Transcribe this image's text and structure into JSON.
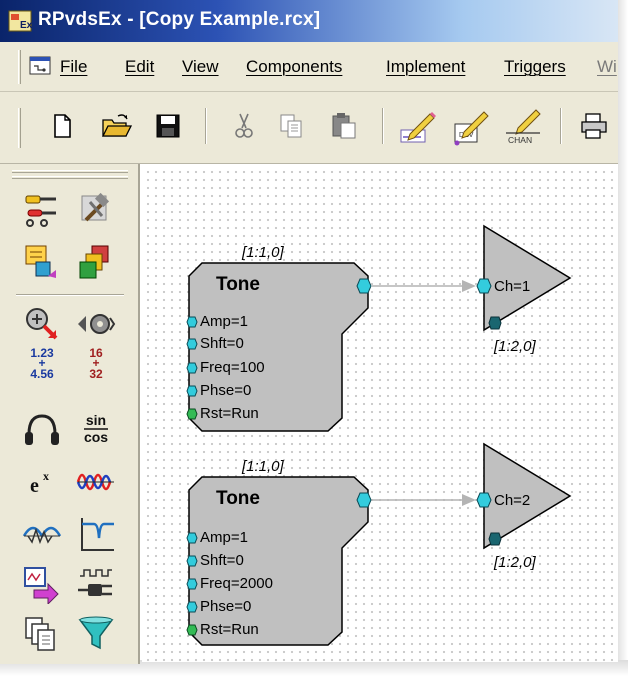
{
  "window": {
    "title": "RPvdsEx - [Copy Example.rcx]"
  },
  "menu": {
    "items": [
      "File",
      "Edit",
      "View",
      "Components",
      "Implement",
      "Triggers",
      "Wi"
    ]
  },
  "toolbar": {
    "icons": [
      "new-icon",
      "open-folder-icon",
      "save-disk-icon",
      "cut-scissors-icon",
      "copy-icon",
      "paste-icon",
      "pencil-write-icon",
      "pencil-device-icon",
      "pencil-chan-icon",
      "print-icon"
    ],
    "chan_label": "CHAN"
  },
  "palette": {
    "icons": [
      "tool-connect-icon",
      "hammer-wrench-icon",
      "component-arrange-icon",
      "cube-stack-icon",
      "probe-arrow-icon",
      "signal-gear-icon",
      "numeric-math-icon",
      "integer-math-icon",
      "headphones-icon",
      "trig-icon",
      "exponent-icon",
      "waveform-icon",
      "filter-notch-icon",
      "filter-response-icon",
      "device-arrow-icon",
      "pulse-plug-icon",
      "copy-pages-icon",
      "funnel-icon"
    ],
    "math_numbers": [
      "1.23",
      "+",
      "4.56"
    ],
    "int_numbers": [
      "16",
      "+",
      "32"
    ],
    "trig": [
      "sin",
      "cos"
    ],
    "exp": [
      "e",
      "x"
    ]
  },
  "canvas": {
    "tone_blocks": [
      {
        "position_label": "[1:1,0]",
        "title": "Tone",
        "ports": [
          "Amp=1",
          "Shft=0",
          "Freq=100",
          "Phse=0",
          "Rst=Run"
        ]
      },
      {
        "position_label": "[1:1,0]",
        "title": "Tone",
        "ports": [
          "Amp=1",
          "Shft=0",
          "Freq=2000",
          "Phse=0",
          "Rst=Run"
        ]
      }
    ],
    "outputs": [
      {
        "label": "Ch=1",
        "position_label": "[1:2,0]"
      },
      {
        "label": "Ch=2",
        "position_label": "[1:2,0]"
      }
    ]
  },
  "colors": {
    "block_fill": "#c0c0c0",
    "port_input": "#33ccdd",
    "port_reset": "#33bb55",
    "port_dark": "#1a6670",
    "wire": "#b4b4b4"
  }
}
